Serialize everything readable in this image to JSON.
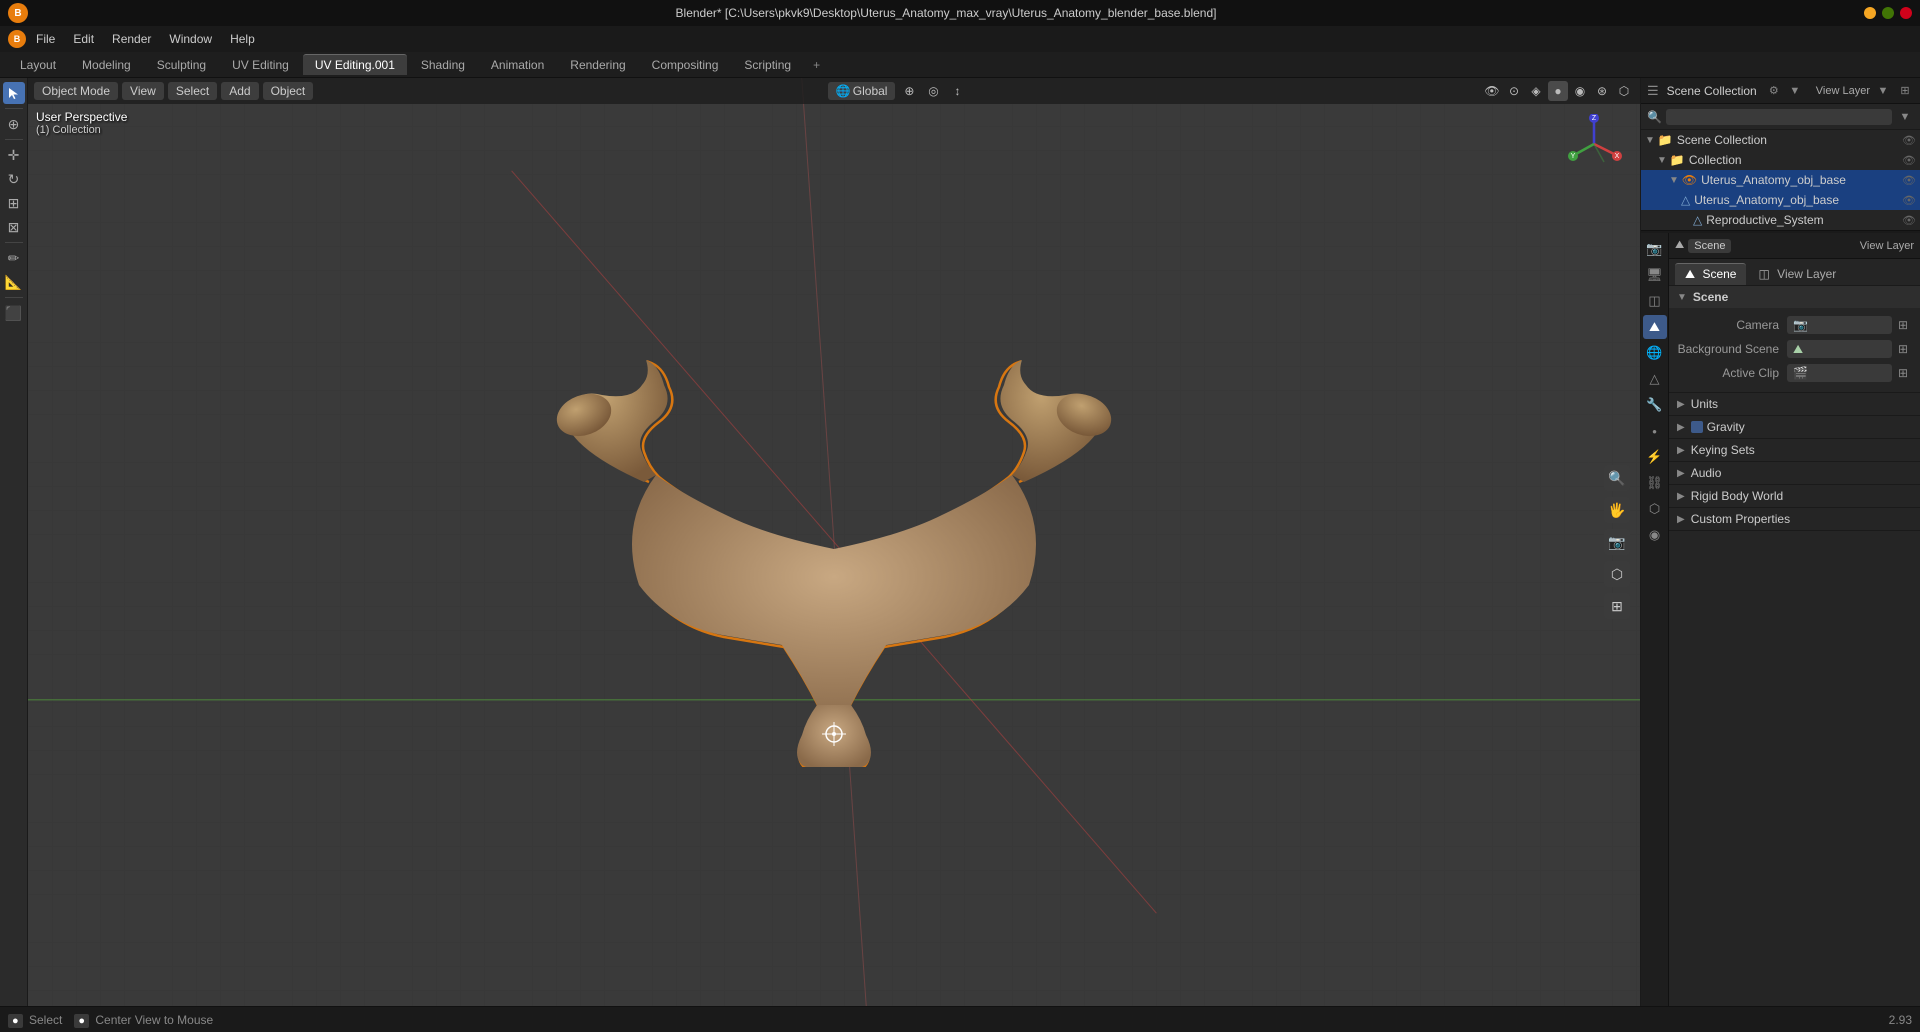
{
  "titlebar": {
    "title": "Blender* [C:\\Users\\pkvk9\\Desktop\\Uterus_Anatomy_max_vray\\Uterus_Anatomy_blender_base.blend]"
  },
  "menubar": {
    "items": [
      "File",
      "Edit",
      "Render",
      "Window",
      "Help"
    ]
  },
  "workspace_tabs": {
    "tabs": [
      "Layout",
      "Modeling",
      "Sculpting",
      "UV Editing",
      "UV Editing.001",
      "Shading",
      "Animation",
      "Rendering",
      "Compositing",
      "Scripting"
    ],
    "active": "UV Editing.001",
    "plus_label": "+"
  },
  "viewport": {
    "header": {
      "mode": "Object Mode",
      "view_label": "View",
      "select_label": "Select",
      "add_label": "Add",
      "object_label": "Object",
      "transform_global": "Global",
      "transform_icon": "⊕"
    },
    "perspective": "User Perspective",
    "collection": "(1) Collection",
    "overlay_icons": [
      "🔍",
      "⊙",
      "◉",
      "⊕",
      "▣",
      "◈"
    ]
  },
  "outliner": {
    "title": "Scene Collection",
    "search_placeholder": "",
    "tree": [
      {
        "level": 0,
        "label": "Scene Collection",
        "icon": "📁",
        "expanded": true,
        "eye": true
      },
      {
        "level": 1,
        "label": "Collection",
        "icon": "📁",
        "expanded": true,
        "eye": true
      },
      {
        "level": 2,
        "label": "Uterus_Anatomy_obj_base",
        "icon": "👁",
        "expanded": true,
        "eye": true,
        "selected": true
      },
      {
        "level": 3,
        "label": "Uterus_Anatomy_obj_base",
        "icon": "△",
        "expanded": false,
        "eye": true
      },
      {
        "level": 4,
        "label": "Reproductive_System",
        "icon": "△",
        "expanded": false,
        "eye": true
      }
    ]
  },
  "scene_viewlayer_bar": {
    "scene_label": "Scene",
    "scene_value": "Scene",
    "viewlayer_label": "View Layer",
    "viewlayer_value": "View Layer"
  },
  "props_tabs": {
    "tabs": [
      {
        "id": "render",
        "icon": "📷",
        "label": "Render"
      },
      {
        "id": "output",
        "icon": "🖥",
        "label": "Output"
      },
      {
        "id": "view_layer",
        "icon": "◫",
        "label": "View Layer"
      },
      {
        "id": "scene",
        "icon": "⛰",
        "label": "Scene",
        "active": true
      },
      {
        "id": "world",
        "icon": "🌐",
        "label": "World"
      },
      {
        "id": "object",
        "icon": "△",
        "label": "Object"
      },
      {
        "id": "modifier",
        "icon": "🔧",
        "label": "Modifier"
      },
      {
        "id": "particles",
        "icon": "•",
        "label": "Particles"
      },
      {
        "id": "physics",
        "icon": "〒",
        "label": "Physics"
      },
      {
        "id": "constraints",
        "icon": "⛓",
        "label": "Constraints"
      },
      {
        "id": "data",
        "icon": "⬡",
        "label": "Data"
      },
      {
        "id": "material",
        "icon": "◉",
        "label": "Material"
      }
    ]
  },
  "scene_tabs": {
    "scene_label": "Scene",
    "viewlayer_label": "View Layer"
  },
  "scene_props": {
    "scene_section": {
      "label": "Scene",
      "camera_label": "Camera",
      "camera_value": "",
      "bg_scene_label": "Background Scene",
      "bg_scene_value": "",
      "active_clip_label": "Active Clip",
      "active_clip_value": ""
    },
    "units_section": {
      "label": "Units",
      "collapsed": false
    },
    "gravity_section": {
      "label": "Gravity",
      "enabled": true,
      "collapsed": false
    },
    "keying_sets_section": {
      "label": "Keying Sets",
      "collapsed": false
    },
    "audio_section": {
      "label": "Audio",
      "collapsed": false
    },
    "rigid_body_world_section": {
      "label": "Rigid Body World",
      "collapsed": false
    },
    "custom_props_section": {
      "label": "Custom Properties",
      "collapsed": false
    }
  },
  "statusbar": {
    "select_label": "Select",
    "select_key": "LMB",
    "center_label": "Center View to Mouse",
    "center_key": "MMB",
    "version": "2.93"
  },
  "axis_widget": {
    "x_color": "#d04040",
    "y_color": "#40a040",
    "z_color": "#4040d0",
    "x_label": "X",
    "y_label": "Y",
    "z_label": "Z"
  },
  "colors": {
    "accent_blue": "#4772b3",
    "accent_orange": "#e87d0d",
    "selection_outline": "#f5a623",
    "grid_line": "#333333",
    "header_bg": "#1e1e1e",
    "panel_bg": "#252525",
    "active_tab_bg": "#3d3d3d"
  }
}
